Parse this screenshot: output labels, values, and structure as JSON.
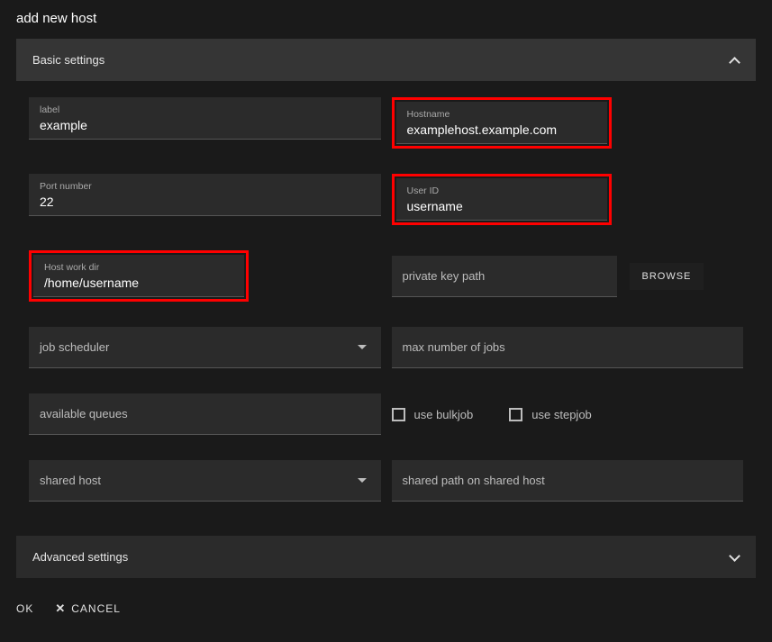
{
  "title": "add new host",
  "panels": {
    "basic": {
      "title": "Basic settings",
      "expanded": true,
      "fields": {
        "label": {
          "label": "label",
          "value": "example"
        },
        "hostname": {
          "label": "Hostname",
          "value": "examplehost.example.com"
        },
        "port": {
          "label": "Port number",
          "value": "22"
        },
        "userid": {
          "label": "User ID",
          "value": "username"
        },
        "workdir": {
          "label": "Host work dir",
          "value": "/home/username"
        },
        "pkey": {
          "label": "private key path"
        },
        "browse": "BROWSE",
        "scheduler": {
          "label": "job scheduler"
        },
        "maxjobs": {
          "label": "max number of jobs"
        },
        "queues": {
          "label": "available queues"
        },
        "bulkjob": {
          "label": "use bulkjob",
          "checked": false
        },
        "stepjob": {
          "label": "use stepjob",
          "checked": false
        },
        "sharedhost": {
          "label": "shared host"
        },
        "sharedpath": {
          "label": "shared path on shared host"
        }
      }
    },
    "advanced": {
      "title": "Advanced settings",
      "expanded": false
    }
  },
  "footer": {
    "ok": "OK",
    "cancel": "CANCEL"
  }
}
